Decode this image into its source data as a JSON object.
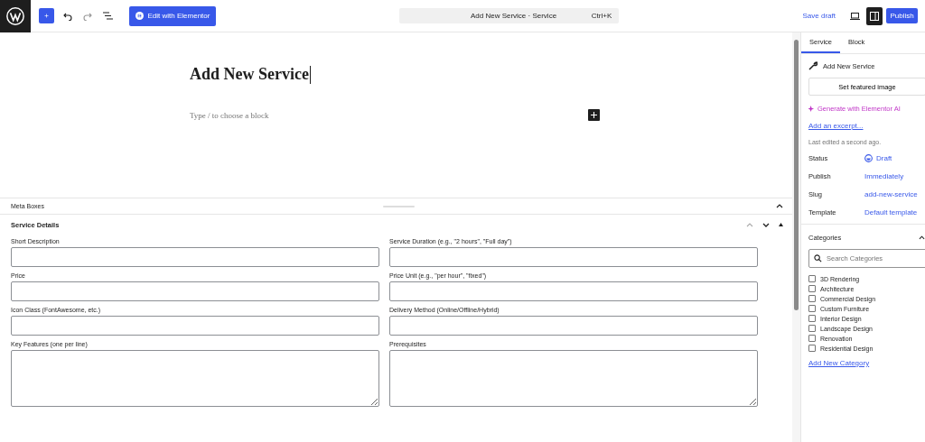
{
  "toolbar": {
    "edit_button": "Edit with Elementor",
    "command_bar": {
      "title": "Add New Service · Service",
      "shortcut": "Ctrl+K"
    },
    "save_draft": "Save draft",
    "settings_active": true,
    "publish": "Publish"
  },
  "editor": {
    "title": "Add New Service",
    "block_placeholder": "Type / to choose a block"
  },
  "meta_boxes": {
    "title": "Meta Boxes",
    "section": {
      "title": "Service Details",
      "fields": [
        {
          "label": "Short Description",
          "kind": "input"
        },
        {
          "label": "Service Duration (e.g., \"2 hours\", \"Full day\")",
          "kind": "input"
        },
        {
          "label": "Price",
          "kind": "input"
        },
        {
          "label": "Price Unit (e.g., \"per hour\", \"fixed\")",
          "kind": "input"
        },
        {
          "label": "Icon Class (FontAwesome, etc.)",
          "kind": "input"
        },
        {
          "label": "Delivery Method (Online/Offline/Hybrid)",
          "kind": "input"
        },
        {
          "label": "Key Features (one per line)",
          "kind": "textarea"
        },
        {
          "label": "Prerequisites",
          "kind": "textarea"
        }
      ]
    }
  },
  "sidebar": {
    "tabs": [
      {
        "label": "Service",
        "selected": true
      },
      {
        "label": "Block",
        "selected": false
      }
    ],
    "post_title": "Add New Service",
    "featured_button": "Set featured image",
    "ai_link": "Generate with Elementor AI",
    "excerpt_link": "Add an excerpt...",
    "last_edited": "Last edited a second ago.",
    "summary": [
      {
        "label": "Status",
        "value": "Draft",
        "kind": "status"
      },
      {
        "label": "Publish",
        "value": "Immediately",
        "kind": "link"
      },
      {
        "label": "Slug",
        "value": "add-new-service",
        "kind": "link"
      },
      {
        "label": "Template",
        "value": "Default template",
        "kind": "link"
      }
    ],
    "categories": {
      "title": "Categories",
      "search_placeholder": "Search Categories",
      "items": [
        {
          "label": "3D Rendering",
          "checked": false
        },
        {
          "label": "Architecture",
          "checked": false
        },
        {
          "label": "Commercial Design",
          "checked": false
        },
        {
          "label": "Custom Furniture",
          "checked": false
        },
        {
          "label": "Interior Design",
          "checked": false
        },
        {
          "label": "Landscape Design",
          "checked": false
        },
        {
          "label": "Renovation",
          "checked": false
        },
        {
          "label": "Residential Design",
          "checked": false
        }
      ],
      "add_link": "Add New Category"
    }
  }
}
